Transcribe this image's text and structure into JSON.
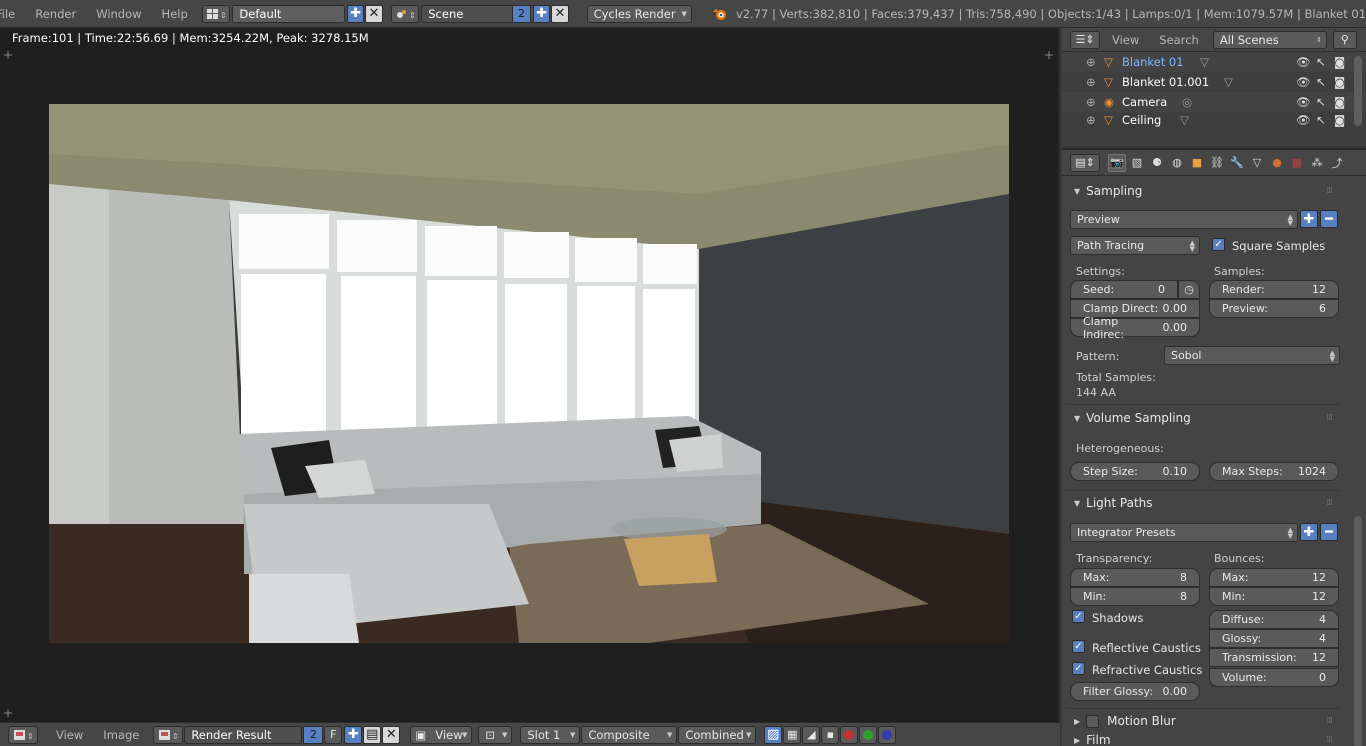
{
  "topbar": {
    "menus": [
      "File",
      "Render",
      "Window",
      "Help"
    ],
    "screen_layout": "Default",
    "scene": "Scene",
    "scene_users": "2",
    "render_engine": "Cycles Render",
    "stats": "v2.77 | Verts:382,810 | Faces:379,437 | Tris:758,490 | Objects:1/43 | Lamps:0/1 | Mem:1079.57M | Blanket 01"
  },
  "viewport": {
    "render_info": "Frame:101 | Time:22:56.69 | Mem:3254.22M, Peak: 3278.15M"
  },
  "bottombar": {
    "view_menu": "View",
    "image_menu": "Image",
    "image_name": "Render Result",
    "image_users": "2",
    "fake_user": "F",
    "view_dd": "View",
    "slot": "Slot 1",
    "layer": "Composite",
    "pass": "Combined"
  },
  "outliner": {
    "view_menu": "View",
    "search_menu": "Search",
    "display_mode": "All Scenes",
    "items": [
      {
        "label": "Blanket 01",
        "selected": true
      },
      {
        "label": "Blanket 01.001",
        "selected": false
      },
      {
        "label": "Camera",
        "selected": false
      },
      {
        "label": "Ceiling",
        "selected": false
      }
    ]
  },
  "properties": {
    "sampling": {
      "title": "Sampling",
      "preset": "Preview",
      "integrator": "Path Tracing",
      "square_samples_label": "Square Samples",
      "square_samples": true,
      "settings_label": "Settings:",
      "samples_label": "Samples:",
      "seed_label": "Seed:",
      "seed_value": "0",
      "clamp_direct_label": "Clamp Direct:",
      "clamp_direct_value": "0.00",
      "clamp_indirect_label": "Clamp Indirec:",
      "clamp_indirect_value": "0.00",
      "render_label": "Render:",
      "render_value": "12",
      "preview_label": "Preview:",
      "preview_value": "6",
      "pattern_label": "Pattern:",
      "pattern_value": "Sobol",
      "total_label": "Total Samples:",
      "total_value": "144 AA"
    },
    "volume": {
      "title": "Volume Sampling",
      "heterogeneous_label": "Heterogeneous:",
      "step_label": "Step Size:",
      "step_value": "0.10",
      "max_steps_label": "Max Steps:",
      "max_steps_value": "1024"
    },
    "light_paths": {
      "title": "Light Paths",
      "preset": "Integrator Presets",
      "transparency_label": "Transparency:",
      "bounces_label": "Bounces:",
      "t_max_label": "Max:",
      "t_max_value": "8",
      "t_min_label": "Min:",
      "t_min_value": "8",
      "b_max_label": "Max:",
      "b_max_value": "12",
      "b_min_label": "Min:",
      "b_min_value": "12",
      "shadows_label": "Shadows",
      "reflective_label": "Reflective Caustics",
      "refractive_label": "Refractive Caustics",
      "filter_glossy_label": "Filter Glossy:",
      "filter_glossy_value": "0.00",
      "diffuse_label": "Diffuse:",
      "diffuse_value": "4",
      "glossy_label": "Glossy:",
      "glossy_value": "4",
      "transmission_label": "Transmission:",
      "transmission_value": "12",
      "volume_label": "Volume:",
      "volume_value": "0"
    },
    "motion_blur": {
      "title": "Motion Blur"
    },
    "film": {
      "title": "Film"
    }
  },
  "colors": {
    "accent_blue": "#5680c2",
    "panel_bg": "#444444",
    "header_bg": "#464646",
    "selected_text": "#7fb8ff"
  }
}
